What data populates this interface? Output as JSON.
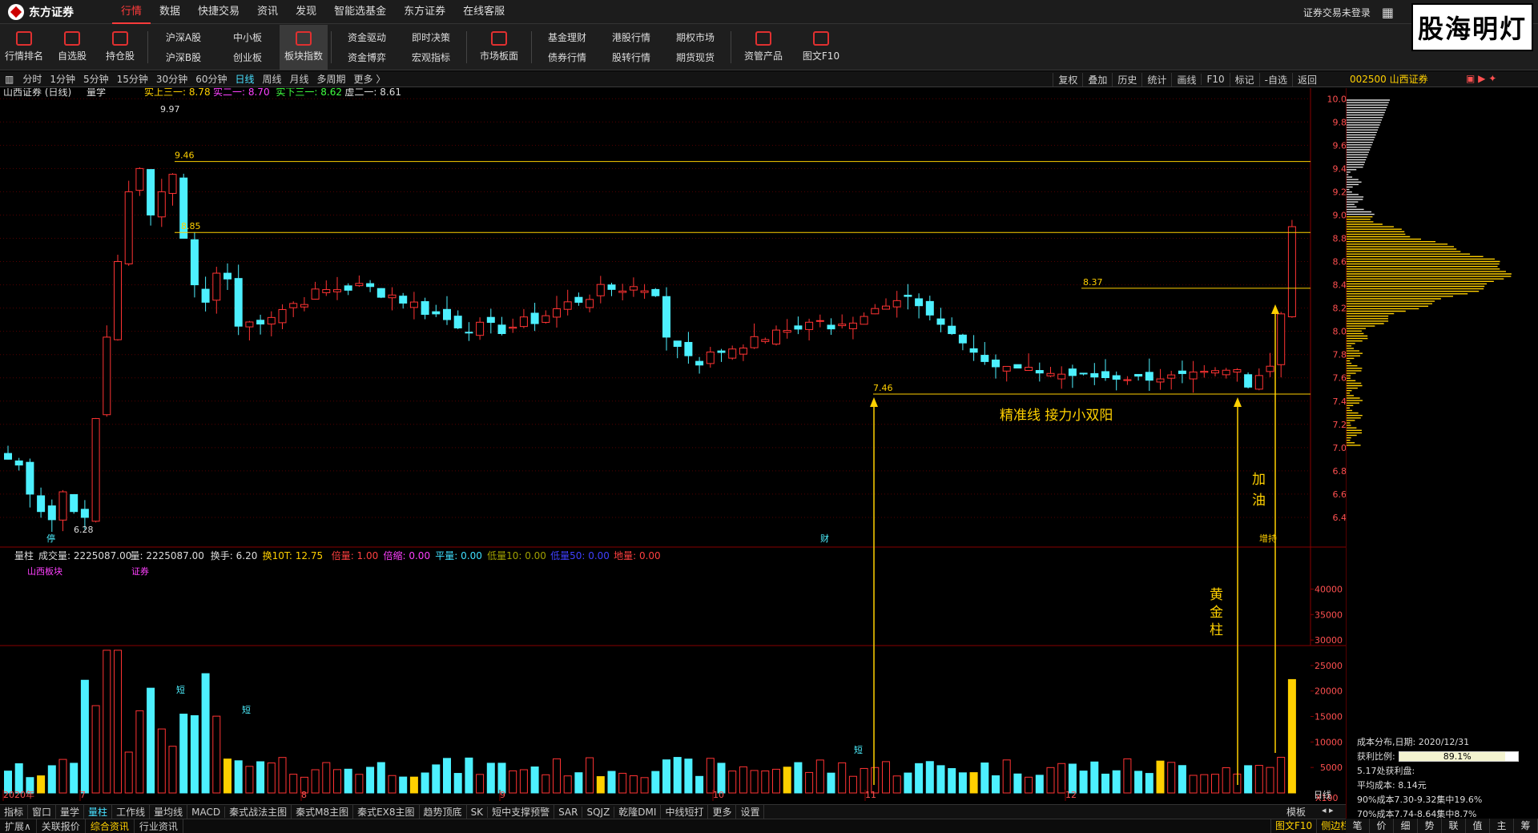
{
  "app": {
    "logo_text": "东方证券",
    "menu": [
      "行情",
      "数据",
      "快捷交易",
      "资讯",
      "发现",
      "智能选基金",
      "东方证券",
      "在线客服"
    ],
    "active_menu": 0,
    "login_status": "证券交易未登录",
    "brand_box": "股海明灯"
  },
  "toolbar": {
    "icon_tools": [
      {
        "label": "行情排名"
      },
      {
        "label": "自选股"
      },
      {
        "label": "持仓股"
      }
    ],
    "pair_tools": [
      {
        "top": "沪深A股",
        "bottom": "沪深B股"
      },
      {
        "top": "中小板",
        "bottom": "创业板"
      }
    ],
    "active_tool": "板块指数",
    "pair_tools2": [
      {
        "top": "资金驱动",
        "bottom": "资金博弈"
      },
      {
        "top": "即时决策",
        "bottom": "宏观指标"
      }
    ],
    "market_tool": "市场板面",
    "pair_tools3": [
      {
        "top": "基金理财",
        "bottom": "债券行情"
      },
      {
        "top": "港股行情",
        "bottom": "股转行情"
      },
      {
        "top": "期权市场",
        "bottom": "期货现货"
      }
    ],
    "asset_tool": "资管产品",
    "f10_tool": "图文F10"
  },
  "periodbar": {
    "periods": [
      "分时",
      "1分钟",
      "5分钟",
      "15分钟",
      "30分钟",
      "60分钟",
      "日线",
      "周线",
      "月线",
      "多周期",
      "更多 〉"
    ],
    "active_period": "日线",
    "right_tools": [
      "复权",
      "叠加",
      "历史",
      "统计",
      "画线",
      "F10",
      "标记",
      "-自选",
      "返回"
    ],
    "stock_code": "002500 山西证券"
  },
  "chart_header": {
    "title": "山西证券 (日线)",
    "indicator": "量学",
    "legends": [
      {
        "text": "实上三一: 8.78",
        "color": "#ffd000"
      },
      {
        "text": "实二一: 8.70",
        "color": "#ff40ff"
      },
      {
        "text": "实下三一: 8.62",
        "color": "#40ff40"
      },
      {
        "text": "虚二一: 8.61",
        "color": "#dddddd"
      }
    ]
  },
  "volume_header": {
    "title": "量柱",
    "items": [
      {
        "text": "成交量: 2225087.00",
        "color": "#dddddd"
      },
      {
        "text": "量: 2225087.00",
        "color": "#dddddd"
      },
      {
        "text": "换手: 6.20",
        "color": "#dddddd"
      },
      {
        "text": "换10T: 12.75",
        "color": "#ffd000"
      },
      {
        "text": "倍量: 1.00",
        "color": "#ff4040"
      },
      {
        "text": "倍缩: 0.00",
        "color": "#ff40ff"
      },
      {
        "text": "平量: 0.00",
        "color": "#40e0ff"
      },
      {
        "text": "低量10: 0.00",
        "color": "#a0a000"
      },
      {
        "text": "低量50: 0.00",
        "color": "#4040ff"
      },
      {
        "text": "地量: 0.00",
        "color": "#ff4040"
      }
    ],
    "tags": [
      "山西板块",
      "证券"
    ]
  },
  "annotations": {
    "line_text": "精准线  接力小双阳",
    "jiayou": "加油",
    "huangjinzhu": "黄金柱",
    "top_price": "9.97",
    "low_price": "6.28",
    "p946": "9.46",
    "p885": "8.85",
    "p837": "8.37",
    "p746": "7.46",
    "markers": {
      "ting": "停",
      "cai": "财",
      "zengchi": "增持"
    },
    "short_labels": [
      "短",
      "短",
      "短"
    ]
  },
  "chart_data": {
    "type": "candlestick",
    "price_axis": [
      "10.00",
      "9.80",
      "9.60",
      "9.40",
      "9.20",
      "9.00",
      "8.80",
      "8.60",
      "8.40",
      "8.20",
      "8.00",
      "7.80",
      "7.60",
      "7.40",
      "7.20",
      "7.00",
      "6.80",
      "6.60",
      "6.40"
    ],
    "volume_axis": [
      "40000",
      "35000",
      "30000",
      "25000",
      "20000",
      "15000",
      "10000",
      "5000"
    ],
    "volume_unit": "X100",
    "xlabels": [
      "2020年",
      "7",
      "8",
      "9",
      "10",
      "11",
      "12",
      "日线"
    ],
    "ylim": [
      6.2,
      10.05
    ],
    "horizontal_lines": [
      9.46,
      8.85,
      8.37,
      7.46
    ],
    "colors": {
      "up": "#ff3333",
      "down": "#4df0ff",
      "gold": "#ffd000",
      "grid": "#550000"
    }
  },
  "right_panel": {
    "cost_date": "成本分布,日期: 2020/12/31",
    "profit_label": "获利比例:",
    "profit_value": "89.1%",
    "profit_disk": "5.17处获利盘:",
    "avg_cost": "平均成本: 8.14元",
    "c90": "90%成本7.30-9.32集中19.6%",
    "c70": "70%成本7.74-8.64集中8.7%"
  },
  "bottom_tabs": [
    "指标",
    "窗口",
    "量学",
    "量柱",
    "工作线",
    "量均线",
    "MACD",
    "秦式战法主图",
    "秦式M8主图",
    "秦式EX8主图",
    "趋势顶底",
    "SK",
    "短中支撑预警",
    "SAR",
    "SQJZ",
    "乾隆DMI",
    "中线短打",
    "更多",
    "设置"
  ],
  "bottom_active": "量柱",
  "bottom_right_label": "模板",
  "statusbar": [
    "扩展∧",
    "关联报价",
    "综合资讯",
    "行业资讯"
  ],
  "status_right": [
    "图文F10",
    "侧边栏"
  ],
  "bottom_right_tabs": [
    "笔",
    "价",
    "细",
    "势",
    "联",
    "值",
    "主",
    "筹"
  ]
}
